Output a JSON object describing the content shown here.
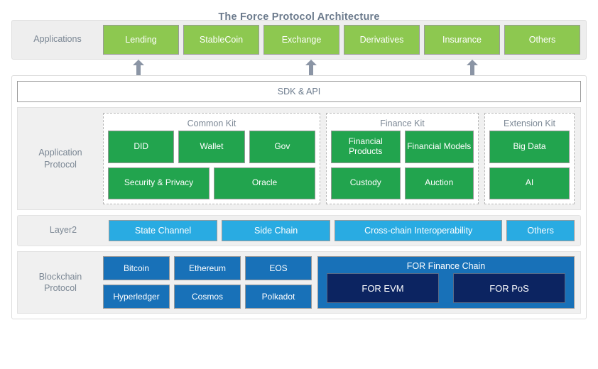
{
  "title": "The Force Protocol Architecture",
  "applications": {
    "label": "Applications",
    "items": [
      {
        "label": "Lending"
      },
      {
        "label": "StableCoin"
      },
      {
        "label": "Exchange"
      },
      {
        "label": "Derivatives"
      },
      {
        "label": "Insurance"
      },
      {
        "label": "Others"
      }
    ]
  },
  "arrows": {
    "icon": "arrow-up-icon",
    "count": 3,
    "positions": [
      185,
      428,
      655
    ],
    "color": "#8b95a5"
  },
  "sdk": {
    "label": "SDK & API"
  },
  "application_protocol": {
    "label": "Application\nProtocol",
    "label_line1": "Application",
    "label_line2": "Protocol",
    "kits": [
      {
        "title": "Common Kit",
        "rows": [
          [
            {
              "label": "DID"
            },
            {
              "label": "Wallet"
            },
            {
              "label": "Gov"
            }
          ],
          [
            {
              "label": "Security & Privacy"
            },
            {
              "label": "Oracle"
            }
          ]
        ]
      },
      {
        "title": "Finance Kit",
        "rows": [
          [
            {
              "label": "Financial Products"
            },
            {
              "label": "Financial Models"
            }
          ],
          [
            {
              "label": "Custody"
            },
            {
              "label": "Auction"
            }
          ]
        ]
      },
      {
        "title": "Extension Kit",
        "rows": [
          [
            {
              "label": "Big Data"
            }
          ],
          [
            {
              "label": "AI"
            }
          ]
        ]
      }
    ]
  },
  "layer2": {
    "label": "Layer2",
    "items": [
      {
        "label": "State Channel"
      },
      {
        "label": "Side Chain"
      },
      {
        "label": "Cross-chain Interoperability"
      },
      {
        "label": "Others"
      }
    ]
  },
  "blockchain_protocol": {
    "label_line1": "Blockchain",
    "label_line2": "Protocol",
    "chains": [
      [
        {
          "label": "Bitcoin"
        },
        {
          "label": "Ethereum"
        },
        {
          "label": "EOS"
        }
      ],
      [
        {
          "label": "Hyperledger"
        },
        {
          "label": "Cosmos"
        },
        {
          "label": "Polkadot"
        }
      ]
    ],
    "for_chain": {
      "title": "FOR Finance Chain",
      "items": [
        {
          "label": "FOR EVM"
        },
        {
          "label": "FOR PoS"
        }
      ]
    }
  },
  "colors": {
    "green_light": "#8dc850",
    "green_dark": "#22a44e",
    "blue_light": "#29abe2",
    "blue_mid": "#1871b8",
    "navy": "#0c2461",
    "band_gray": "#eeeeee",
    "text_gray": "#7b8794",
    "arrow_gray": "#8b95a5"
  }
}
